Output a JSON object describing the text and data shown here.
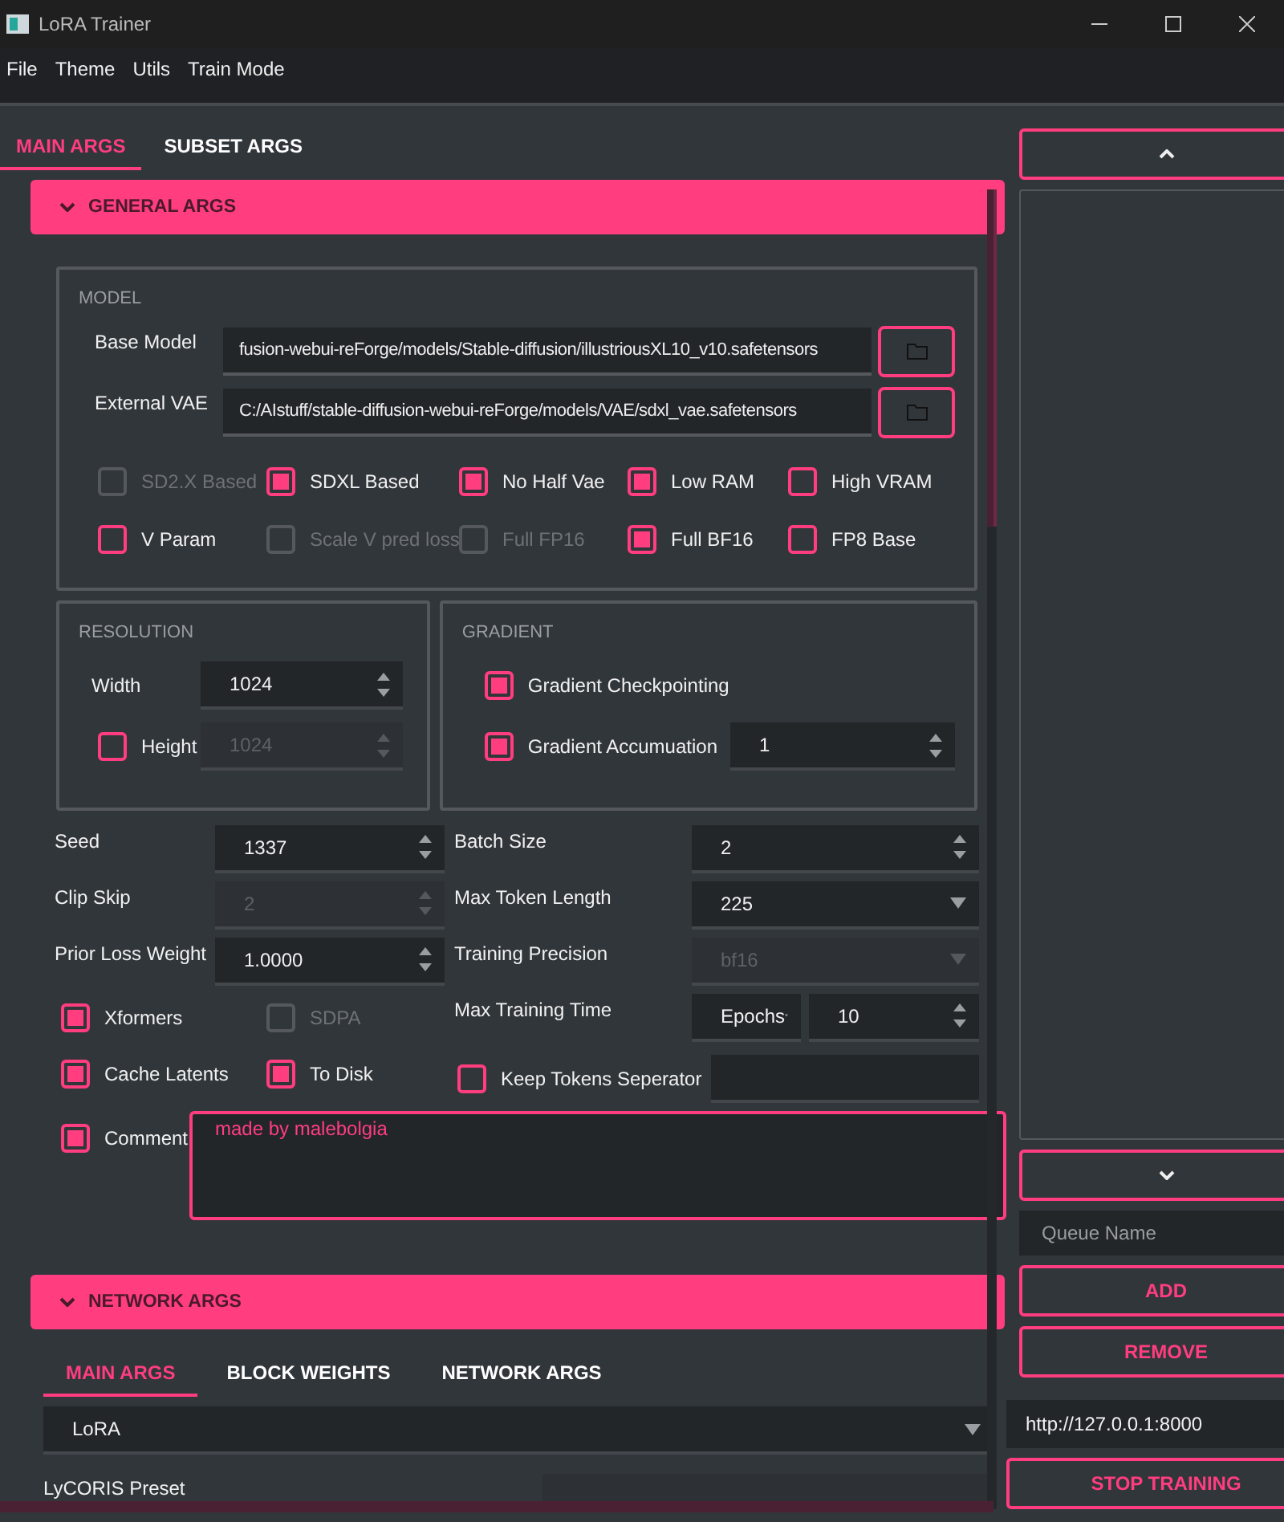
{
  "window": {
    "title": "LoRA Trainer"
  },
  "menu": [
    "File",
    "Theme",
    "Utils",
    "Train Mode"
  ],
  "tabs": [
    {
      "label": "MAIN ARGS",
      "selected": true
    },
    {
      "label": "SUBSET ARGS",
      "selected": false
    }
  ],
  "general": {
    "title": "GENERAL ARGS",
    "expanded": true,
    "model": {
      "title": "MODEL",
      "paths": [
        {
          "label": "Base Model",
          "value": "fusion-webui-reForge/models/Stable-diffusion/illustriousXL10_v10.safetensors"
        },
        {
          "label": "External VAE",
          "value": "C:/AIstuff/stable-diffusion-webui-reForge/models/VAE/sdxl_vae.safetensors"
        }
      ],
      "checkbox_rows": [
        [
          {
            "label": "SD2.X Based",
            "checked": false,
            "disabled": true
          },
          {
            "label": "SDXL Based",
            "checked": true,
            "disabled": false
          },
          {
            "label": "No Half Vae",
            "checked": true,
            "disabled": false
          },
          {
            "label": "Low RAM",
            "checked": true,
            "disabled": false
          },
          {
            "label": "High VRAM",
            "checked": false,
            "disabled": false
          }
        ],
        [
          {
            "label": "V Param",
            "checked": false,
            "disabled": false
          },
          {
            "label": "Scale V pred loss",
            "checked": false,
            "disabled": true
          },
          {
            "label": "Full FP16",
            "checked": false,
            "disabled": true
          },
          {
            "label": "Full BF16",
            "checked": true,
            "disabled": false
          },
          {
            "label": "FP8 Base",
            "checked": false,
            "disabled": false
          }
        ]
      ]
    },
    "resolution": {
      "title": "RESOLUTION",
      "rows": [
        {
          "kind": "plain",
          "label": "Width",
          "value": "1024",
          "disabled": false
        },
        {
          "kind": "checkbox",
          "label": "Height",
          "value": "1024",
          "checked": false,
          "disabled": true
        }
      ]
    },
    "gradient": {
      "title": "GRADIENT",
      "rows": [
        {
          "label": "Gradient Checkpointing",
          "checked": true
        },
        {
          "label": "Gradient Accumuation",
          "checked": true,
          "value": "1"
        }
      ]
    },
    "left_rows": [
      {
        "kind": "spin",
        "label": "Seed",
        "value": "1337",
        "disabled": false
      },
      {
        "kind": "spin",
        "label": "Clip Skip",
        "value": "2",
        "disabled": true
      },
      {
        "kind": "spin",
        "label": "Prior Loss Weight",
        "value": "1.0000",
        "disabled": false
      },
      {
        "kind": "checks",
        "items": [
          {
            "label": "Xformers",
            "checked": true,
            "disabled": false
          },
          {
            "label": "SDPA",
            "checked": false,
            "disabled": true
          }
        ]
      },
      {
        "kind": "checks",
        "items": [
          {
            "label": "Cache Latents",
            "checked": true,
            "disabled": false
          },
          {
            "label": "To Disk",
            "checked": true,
            "disabled": false
          }
        ]
      }
    ],
    "right_rows": [
      {
        "kind": "spin",
        "label": "Batch Size",
        "value": "2",
        "disabled": false
      },
      {
        "kind": "select",
        "label": "Max Token Length",
        "value": "225",
        "disabled": false
      },
      {
        "kind": "select",
        "label": "Training Precision",
        "value": "bf16",
        "disabled": true
      },
      {
        "kind": "unit_spin",
        "label": "Max Training Time",
        "unit": "Epochs",
        "value": "10",
        "disabled": false
      },
      {
        "kind": "check_text",
        "label": "Keep Tokens Seperator",
        "checked": false
      }
    ],
    "comment": {
      "label": "Comment",
      "checked": true,
      "value": "made by malebolgia"
    }
  },
  "network": {
    "title": "NETWORK ARGS",
    "expanded": true,
    "tabs": [
      {
        "label": "MAIN ARGS",
        "selected": true
      },
      {
        "label": "BLOCK WEIGHTS",
        "selected": false
      },
      {
        "label": "NETWORK ARGS",
        "selected": false
      }
    ],
    "algo": {
      "value": "LoRA"
    },
    "preset": {
      "label": "LyCORIS Preset"
    }
  },
  "queue": {
    "name_placeholder": "Queue Name",
    "add": "ADD",
    "remove": "REMOVE",
    "url": "http://127.0.0.1:8000",
    "stop": "STOP TRAINING"
  }
}
